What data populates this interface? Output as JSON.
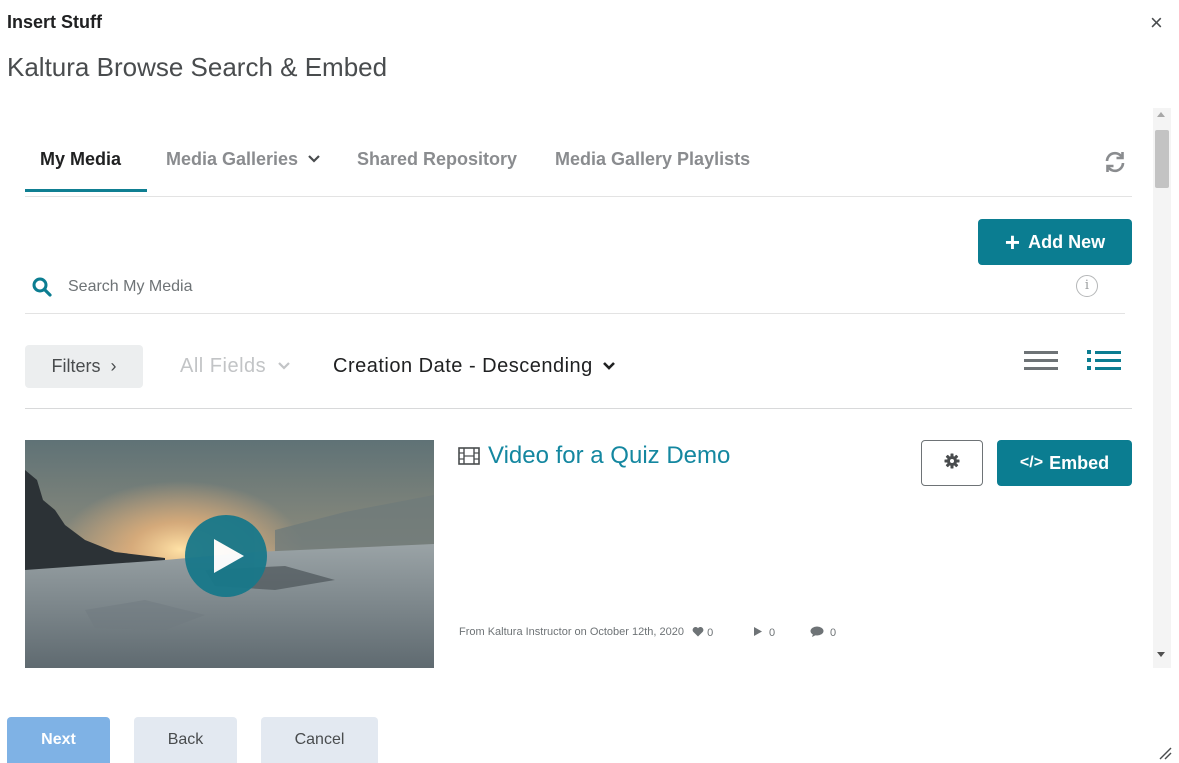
{
  "dialog": {
    "title": "Insert Stuff",
    "close_label": "×",
    "subtitle": "Kaltura Browse Search & Embed"
  },
  "tabs": [
    {
      "label": "My Media",
      "active": true
    },
    {
      "label": "Media Galleries",
      "has_dropdown": true
    },
    {
      "label": "Shared Repository"
    },
    {
      "label": "Media Gallery Playlists"
    }
  ],
  "icons": {
    "refresh": "refresh-icon",
    "search": "search-icon",
    "info": "info-icon",
    "film": "film-icon",
    "gear": "gear-icon",
    "play": "play-icon"
  },
  "toolbar": {
    "add_new_label": "Add New",
    "search_placeholder": "Search My Media",
    "info_glyph": "i",
    "filters_label": "Filters",
    "filters_chevron": "›",
    "all_fields_label": "All Fields",
    "sort_label": "Creation Date - Descending"
  },
  "entry": {
    "title": "Video for a Quiz Demo",
    "embed_label": "Embed",
    "meta": "From Kaltura Instructor on October 12th, 2020",
    "likes": "0",
    "plays": "0",
    "comments": "0"
  },
  "footer": {
    "next_label": "Next",
    "back_label": "Back",
    "cancel_label": "Cancel"
  },
  "colors": {
    "accent": "#0b7d91",
    "link": "#1487a0",
    "next_disabled": "#7fb2e5",
    "secondary_button": "#e3e9f1"
  }
}
